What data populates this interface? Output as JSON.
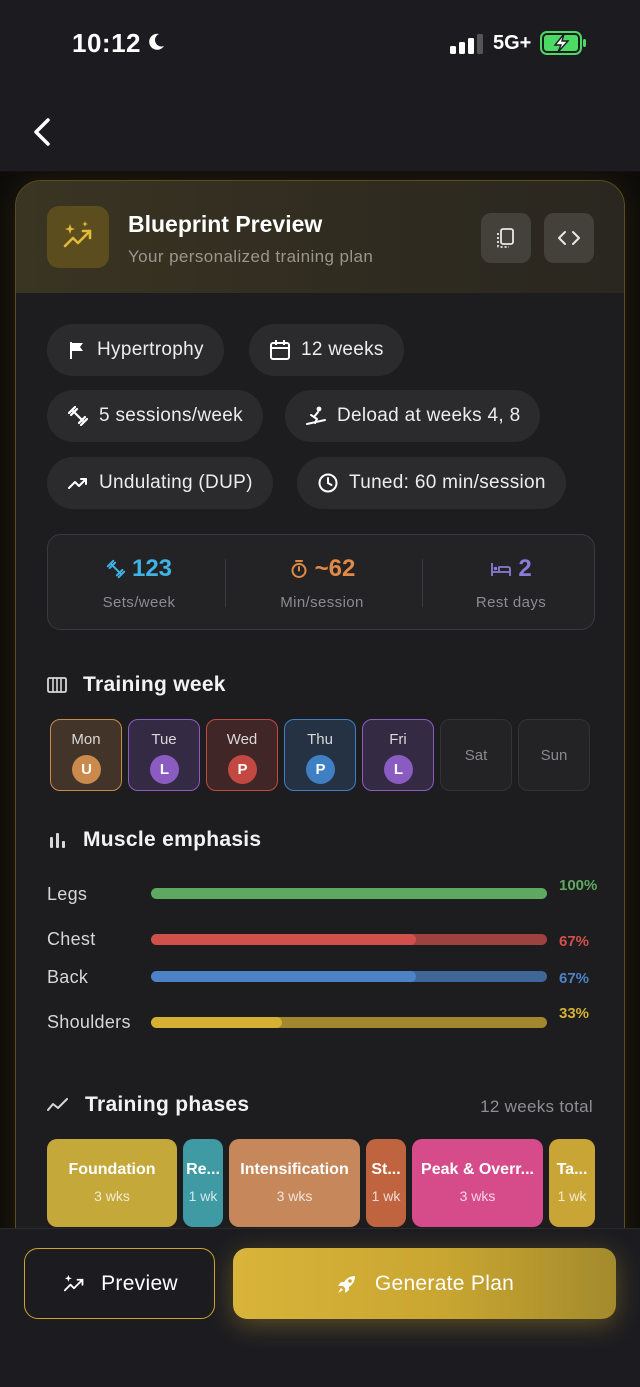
{
  "status": {
    "time": "10:12",
    "network": "5G+"
  },
  "header": {
    "title": "Blueprint Preview",
    "subtitle": "Your personalized training plan"
  },
  "chips": {
    "goal": "Hypertrophy",
    "duration": "12 weeks",
    "frequency": "5 sessions/week",
    "deload": "Deload at weeks 4, 8",
    "periodization": "Undulating (DUP)",
    "tuned": "Tuned: 60 min/session"
  },
  "stats": [
    {
      "value": "123",
      "label": "Sets/week",
      "color": "#3fb3e6"
    },
    {
      "value": "~62",
      "label": "Min/session",
      "color": "#e08a45"
    },
    {
      "value": "2",
      "label": "Rest days",
      "color": "#8a7bd6"
    }
  ],
  "training_week": {
    "title": "Training week",
    "days": [
      {
        "name": "Mon",
        "badge": "U",
        "color": "#c98a4b"
      },
      {
        "name": "Tue",
        "badge": "L",
        "color": "#8a5cc2"
      },
      {
        "name": "Wed",
        "badge": "P",
        "color": "#c44842"
      },
      {
        "name": "Thu",
        "badge": "P",
        "color": "#3f7fc4"
      },
      {
        "name": "Fri",
        "badge": "L",
        "color": "#8a5cc2"
      },
      {
        "name": "Sat",
        "badge": ""
      },
      {
        "name": "Sun",
        "badge": ""
      }
    ]
  },
  "muscle_emphasis": {
    "title": "Muscle emphasis",
    "items": [
      {
        "label": "Legs",
        "value": 1.0,
        "pct": "100%",
        "color": "#5fa85f"
      },
      {
        "label": "Chest",
        "value": 0.67,
        "pct": "67%",
        "color": "#d0504b"
      },
      {
        "label": "Back",
        "value": 0.67,
        "pct": "67%",
        "color": "#4d82c6"
      },
      {
        "label": "Shoulders",
        "value": 0.33,
        "pct": "33%",
        "color": "#d6b033"
      }
    ]
  },
  "phases": {
    "title": "Training phases",
    "total": "12 weeks total",
    "items": [
      {
        "name": "Foundation",
        "weeks": "3 wks",
        "color": "#c4a83a"
      },
      {
        "name": "Re...",
        "weeks": "1 wk",
        "color": "#3f9aa3"
      },
      {
        "name": "Intensification",
        "weeks": "3 wks",
        "color": "#c6885a"
      },
      {
        "name": "St...",
        "weeks": "1 wk",
        "color": "#c0643f"
      },
      {
        "name": "Peak & Overr...",
        "weeks": "3 wks",
        "color": "#d64b8a"
      },
      {
        "name": "Ta...",
        "weeks": "1 wk",
        "color": "#c9a535"
      }
    ]
  },
  "actions": {
    "preview": "Preview",
    "generate": "Generate Plan"
  }
}
